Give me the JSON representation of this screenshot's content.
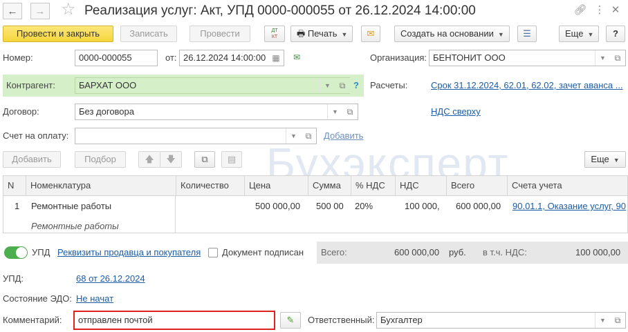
{
  "window": {
    "title": "Реализация услуг: Акт, УПД 0000-000055 от 26.12.2024 14:00:00"
  },
  "toolbar": {
    "post_close": "Провести и закрыть",
    "save": "Записать",
    "post": "Провести",
    "dt_kt": "ДТ КТ",
    "print": "Печать",
    "create_based": "Создать на основании",
    "more": "Еще",
    "help": "?"
  },
  "header": {
    "number_label": "Номер:",
    "number_value": "0000-000055",
    "date_label": "от:",
    "date_value": "26.12.2024 14:00:00",
    "org_label": "Организация:",
    "org_value": "БЕНТОНИТ ООО",
    "counterparty_label": "Контрагент:",
    "counterparty_value": "БАРХАТ ООО",
    "counterparty_help": "?",
    "settlements_label": "Расчеты:",
    "settlements_link": "Срок 31.12.2024, 62.01, 62.02, зачет аванса ...",
    "contract_label": "Договор:",
    "contract_value": "Без договора",
    "vat_link": "НДС сверху",
    "invoice_label": "Счет на оплату:",
    "invoice_value": "",
    "invoice_add_link": "Добавить"
  },
  "table_toolbar": {
    "add": "Добавить",
    "pick": "Подбор",
    "more": "Еще"
  },
  "table": {
    "columns": [
      "N",
      "Номенклатура",
      "Количество",
      "Цена",
      "Сумма",
      "% НДС",
      "НДС",
      "Всего",
      "Счета учета"
    ],
    "rows": [
      {
        "n": "1",
        "item": "Ремонтные работы",
        "item_sub": "Ремонтные работы",
        "qty": "",
        "price": "500 000,00",
        "sum": "500 00",
        "vat_rate": "20%",
        "vat": "100 000,",
        "total": "600 000,00",
        "accounts": "90.01.1, Оказание услуг, 90"
      }
    ]
  },
  "footer": {
    "upd_toggle_label": "УПД",
    "requisites_link": "Реквизиты продавца и покупателя",
    "signed_label": "Документ подписан",
    "total_label": "Всего:",
    "total_value": "600 000,00",
    "currency": "руб.",
    "vat_incl_label": "в т.ч. НДС:",
    "vat_incl_value": "100 000,00",
    "upd_label": "УПД:",
    "upd_link": "68 от 26.12.2024",
    "edo_label": "Состояние ЭДО:",
    "edo_link": "Не начат",
    "comment_label": "Комментарий:",
    "comment_value": "отправлен почтой",
    "responsible_label": "Ответственный:",
    "responsible_value": "Бухгалтер"
  },
  "watermark": "Бухэксперт",
  "colors": {
    "primary_button": "#f5d53c",
    "counterparty_highlight": "#d5f0c8",
    "link": "#1c5ca6",
    "comment_border": "#e0201c",
    "toggle_on": "#4cae4c"
  }
}
